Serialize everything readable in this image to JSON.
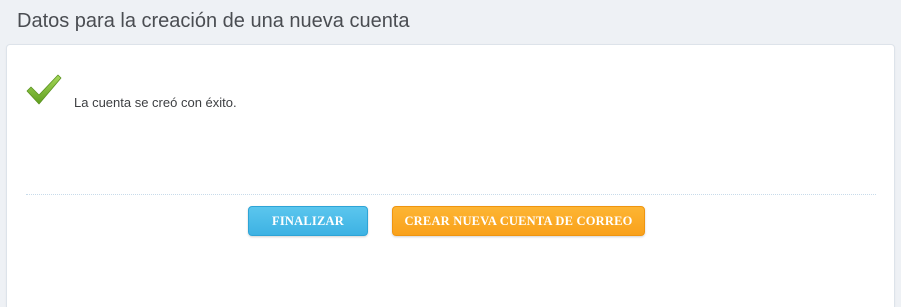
{
  "header": {
    "title": "Datos para la creación de una nueva cuenta"
  },
  "content": {
    "status_icon": "checkmark-icon",
    "status_color": "#7cbf2f",
    "message": "La cuenta se creó con éxito."
  },
  "actions": {
    "finalize_label": "FINALIZAR",
    "finalize_color": "#45b9e8",
    "create_new_label": "CREAR NUEVA CUENTA DE CORREO",
    "create_new_color": "#fbab26"
  }
}
